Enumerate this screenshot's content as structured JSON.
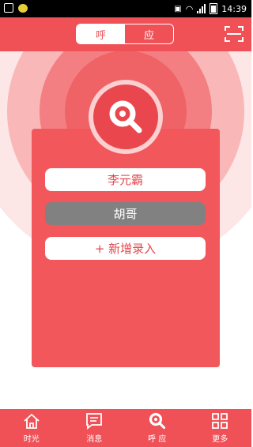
{
  "status_bar": {
    "time": "14:39"
  },
  "header": {
    "segments": [
      {
        "label": "呼",
        "active": true
      },
      {
        "label": "应",
        "active": false
      }
    ],
    "scan_icon": "scan-icon"
  },
  "colors": {
    "brand_red": "#ef5157",
    "card_red": "#f2575c",
    "selected_grey": "#818181"
  },
  "contacts": [
    {
      "name": "李元霸",
      "selected": false
    },
    {
      "name": "胡哥",
      "selected": true
    }
  ],
  "add_entry_label": "+ 新增录入",
  "tabs": [
    {
      "label": "时光",
      "icon": "home-icon"
    },
    {
      "label": "消息",
      "icon": "message-icon"
    },
    {
      "label": "呼 应",
      "icon": "search-logo-icon"
    },
    {
      "label": "更多",
      "icon": "grid-icon"
    }
  ]
}
